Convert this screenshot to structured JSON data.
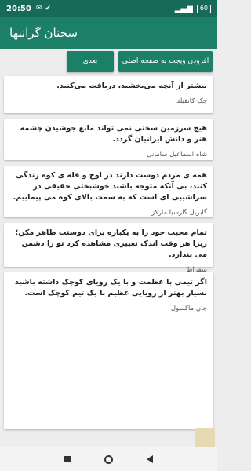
{
  "status_bar": {
    "time": "20:50",
    "battery": "60"
  },
  "app_bar": {
    "title": "سخنان گرانبها"
  },
  "buttons": {
    "add_widget": "افزودن ویجت به صفحه اصلی",
    "next": "بعدی"
  },
  "quotes": [
    {
      "text": "بیشتر از آنچه می‌بخشید، دریافت می‌کنید.",
      "author": "جک کانفیلد"
    },
    {
      "text": "هیچ سرزمین سختی نمی تواند مانع جوشیدن چشمه هنر و دانش ایرانیان گردد.",
      "author": "شاه اسماعیل سامانی"
    },
    {
      "text": "همه ی مردم دوست دارند در اوج و قله ی کوه زندگی کنند، بی آنکه متوجه باشند خوشبختی حقیقی در سراشیبی ای است که به سمت بالای کوه می پیماییم.",
      "author": "گابریل گارسیا مارکز"
    },
    {
      "text": "تمام محبت خود را به یکباره برای دوستت ظاهر مکن؛ زیرا هر وقت اندک تغییری مشاهده کرد تو را دشمن می پندارد.",
      "author": "سقراط"
    },
    {
      "text": "اگر تیمی با عظمت و با یک رویای کوچک داشته باشید بسیار بهتر از رویایی عظیم با یک تیم کوچک است.",
      "author": "جان ماکسول"
    }
  ],
  "colors": {
    "primary": "#1c8068",
    "status_bar": "#176a58",
    "background": "#ededed"
  }
}
